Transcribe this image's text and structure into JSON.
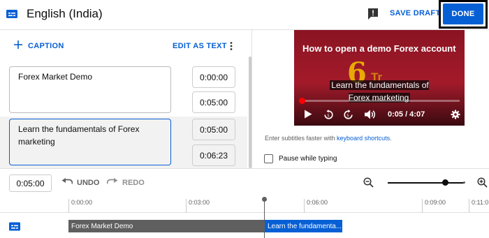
{
  "header": {
    "title": "English (India)",
    "save_draft": "SAVE DRAFT",
    "done": "DONE"
  },
  "editor": {
    "add_caption": "CAPTION",
    "edit_as_text": "EDIT AS TEXT",
    "cues": [
      {
        "text": "Forex Market Demo",
        "start": "0:00:00",
        "end": "0:05:00"
      },
      {
        "text": "Learn the fundamentals of Forex marketing",
        "start": "0:05:00",
        "end": "0:06:23"
      }
    ]
  },
  "player": {
    "video_title": "How to open a demo Forex account",
    "logo_mark": "6",
    "logo_text": "Tr",
    "subtitle": "Learn the fundamentals of Forex marketing",
    "time": "0:05 / 4:07",
    "progress_fraction": 0.02
  },
  "hints": {
    "prefix": "Enter subtitles faster with ",
    "link": "keyboard shortcuts",
    "suffix": ".",
    "pause_label": "Pause while typing"
  },
  "timeline": {
    "current_time": "0:05:00",
    "undo": "UNDO",
    "redo": "REDO",
    "ticks": [
      "0:00:00",
      "0:03:00",
      "0:06:00",
      "0:09:00",
      "0:11:0"
    ],
    "segments": [
      "Forex Market Demo",
      "Learn the fundamenta..."
    ],
    "zoom_fraction": 0.75
  },
  "colors": {
    "accent": "#065fd4",
    "player_red": "#ff0000"
  }
}
